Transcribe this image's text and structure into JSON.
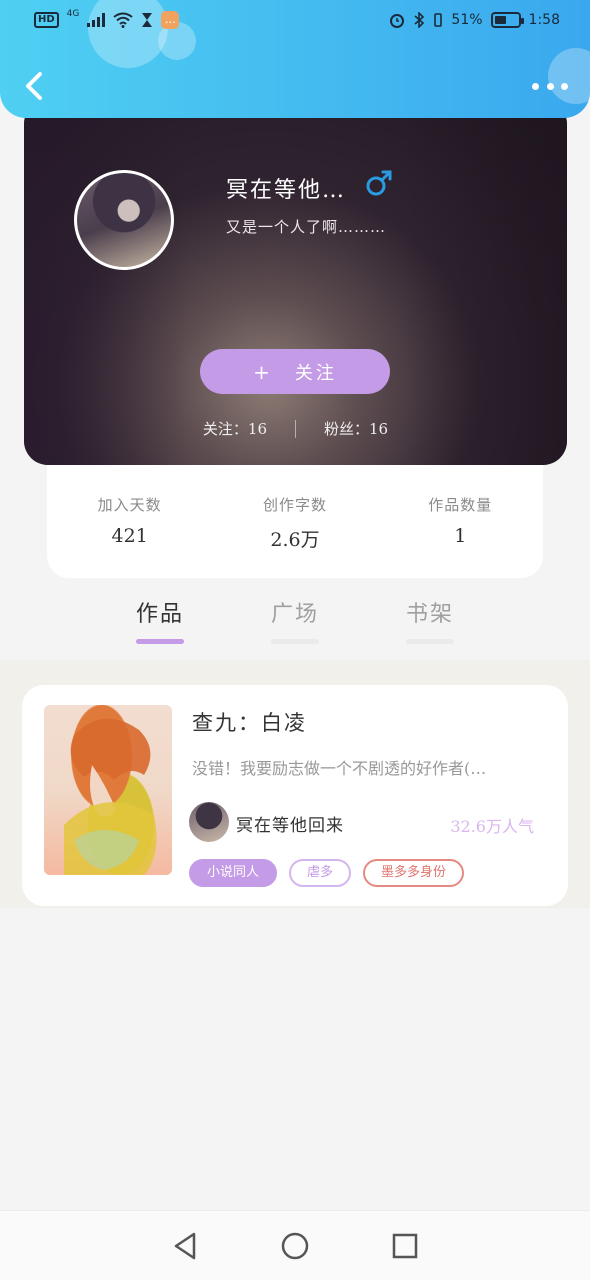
{
  "status_bar": {
    "hd": "HD",
    "network": "4G",
    "battery_percent": "51%",
    "battery_level": 0.51,
    "time": "1:58",
    "message_app_icon": "chat-bubble-icon"
  },
  "header": {
    "back_icon": "chevron-left-icon",
    "more_icon": "more-dots-icon",
    "gradient_start": "#4fd0f2",
    "gradient_end": "#3aa8ee"
  },
  "profile": {
    "username": "冥在等他…",
    "gender_symbol": "♂",
    "gender_color": "#2a9be0",
    "bio": "又是一个人了啊………",
    "follow_button": {
      "icon": "+",
      "label": "关注"
    },
    "following": "关注：16",
    "followers": "粉丝：16"
  },
  "stats": [
    {
      "label": "加入天数",
      "value": "421"
    },
    {
      "label": "创作字数",
      "value": "2.6万"
    },
    {
      "label": "作品数量",
      "value": "1"
    }
  ],
  "tabs": [
    {
      "label": "作品",
      "active": true
    },
    {
      "label": "广场",
      "active": false
    },
    {
      "label": "书架",
      "active": false
    }
  ],
  "work": {
    "title": "查九：白凌",
    "description": "没错！我要励志做一个不剧透的好作者(…",
    "author": "冥在等他回来",
    "popularity": "32.6万人气",
    "tags": [
      "小说同人",
      "虐多",
      "墨多多身份"
    ]
  },
  "colors": {
    "accent": "#c49be6",
    "tag_red": "#e0756d"
  }
}
